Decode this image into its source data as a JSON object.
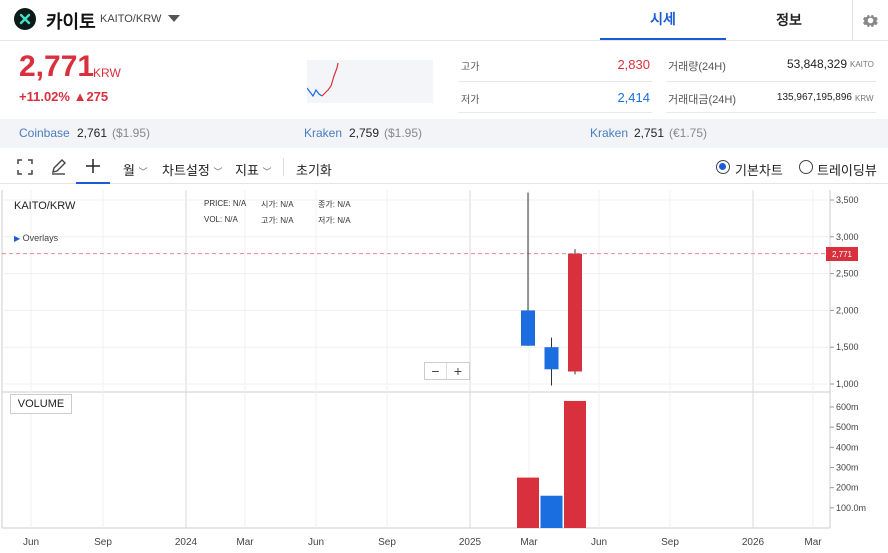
{
  "header": {
    "coin_name": "카이토",
    "pair": "KAITO/KRW",
    "tab_active": "시세",
    "tab_info": "정보"
  },
  "price": {
    "current": "2,771",
    "unit": "KRW",
    "change": "+11.02% ▲275"
  },
  "stats": {
    "high_label": "고가",
    "high_value": "2,830",
    "low_label": "저가",
    "low_value": "2,414",
    "volume_label": "거래량(24H)",
    "volume_value": "53,848,329",
    "volume_unit": "KAITO",
    "amount_label": "거래대금(24H)",
    "amount_value": "135,967,195,896",
    "amount_unit": "KRW"
  },
  "exchanges": [
    {
      "name": "Coinbase",
      "price": "2,761",
      "sub": "($1.95)"
    },
    {
      "name": "Kraken",
      "price": "2,759",
      "sub": "($1.95)"
    },
    {
      "name": "Kraken",
      "price": "2,751",
      "sub": "(€1.75)"
    }
  ],
  "toolbar": {
    "period": "월",
    "chart_settings": "차트설정",
    "indicators": "지표",
    "reset": "초기화",
    "basic_chart": "기본차트",
    "tradingview": "트레이딩뷰"
  },
  "chart_info": {
    "symbol": "KAITO/KRW",
    "overlays": "Overlays",
    "price_label": "PRICE:",
    "price_val": "N/A",
    "open_label": "시가:",
    "open_val": "N/A",
    "close_label": "종가:",
    "close_val": "N/A",
    "vol_label": "VOL:",
    "vol_val": "N/A",
    "high_label": "고가:",
    "high_val": "N/A",
    "low_label": "저가:",
    "low_val": "N/A",
    "volume_panel": "VOLUME",
    "current_price_tag": "2,771"
  },
  "colors": {
    "up": "#d9303e",
    "down": "#1a6ee0",
    "accent": "#1a5bd8"
  },
  "chart_data": {
    "type": "candlestick",
    "price_axis_ticks": [
      "3,500",
      "3,000",
      "2,500",
      "2,000",
      "1,500",
      "1,000"
    ],
    "volume_axis_ticks": [
      "600m",
      "500m",
      "400m",
      "300m",
      "200m",
      "100.0m"
    ],
    "x_ticks": [
      "Jun",
      "Sep",
      "2024",
      "Mar",
      "Jun",
      "Sep",
      "2025",
      "Mar",
      "Jun",
      "Sep",
      "2026",
      "Mar"
    ],
    "candles": [
      {
        "month": "2025-02",
        "open": 2000,
        "close": 1520,
        "high": 3600,
        "low": 1520,
        "direction": "down"
      },
      {
        "month": "2025-03",
        "open": 1500,
        "close": 1200,
        "high": 1630,
        "low": 980,
        "direction": "down"
      },
      {
        "month": "2025-04",
        "open": 1170,
        "close": 2771,
        "high": 2830,
        "low": 1130,
        "direction": "up"
      }
    ],
    "volume": [
      {
        "month": "2025-02",
        "value": 250000000,
        "direction": "up"
      },
      {
        "month": "2025-03",
        "value": 160000000,
        "direction": "down"
      },
      {
        "month": "2025-04",
        "value": 630000000,
        "direction": "up"
      }
    ]
  }
}
